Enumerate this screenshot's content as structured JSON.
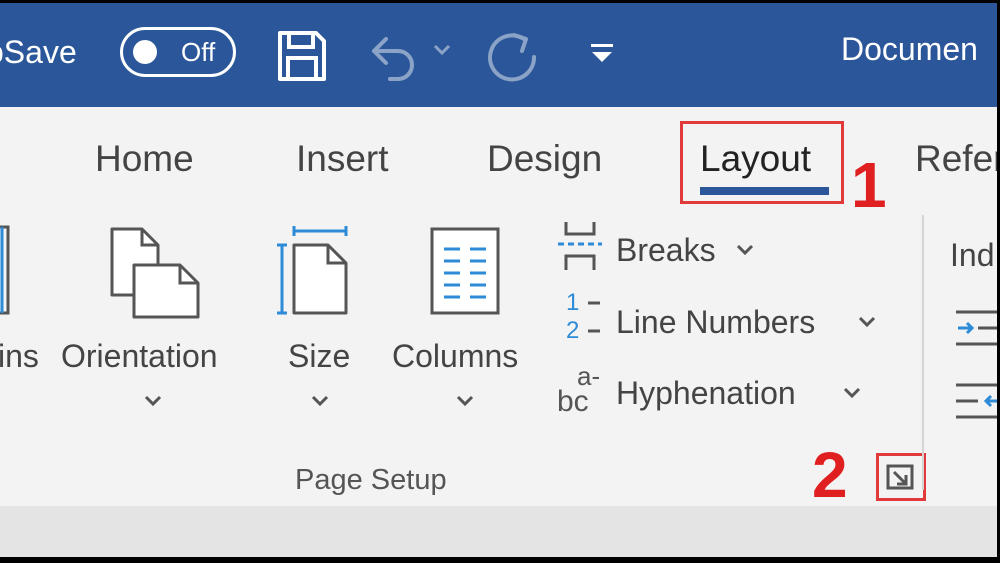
{
  "titlebar": {
    "autosave_label": "oSave",
    "toggle_state": "Off",
    "doc_title": "Documen",
    "bg_color": "#2b579a",
    "icons": [
      "save-icon",
      "undo-icon",
      "redo-icon",
      "customize-toolbar-icon"
    ]
  },
  "tabs": [
    {
      "label": "Home"
    },
    {
      "label": "Insert"
    },
    {
      "label": "Design"
    },
    {
      "label": "Layout",
      "selected": true
    },
    {
      "label": "Refer"
    }
  ],
  "callouts": {
    "one": "1",
    "two": "2"
  },
  "ribbon": {
    "margins_label": "ins",
    "orientation_label": "Orientation",
    "size_label": "Size",
    "columns_label": "Columns",
    "breaks_label": "Breaks",
    "line_numbers_label": "Line Numbers",
    "hyphenation_label": "Hyphenation",
    "line_numbers_icon_top": "1",
    "line_numbers_icon_bottom": "2",
    "hyphenation_icon_top": "a-",
    "hyphenation_icon_bottom": "bc",
    "page_setup_group": "Page Setup",
    "indent_label": "Ind"
  },
  "colors": {
    "accent": "#2b579a",
    "highlight": "#e02020",
    "icon_blue": "#2e8bd8"
  }
}
